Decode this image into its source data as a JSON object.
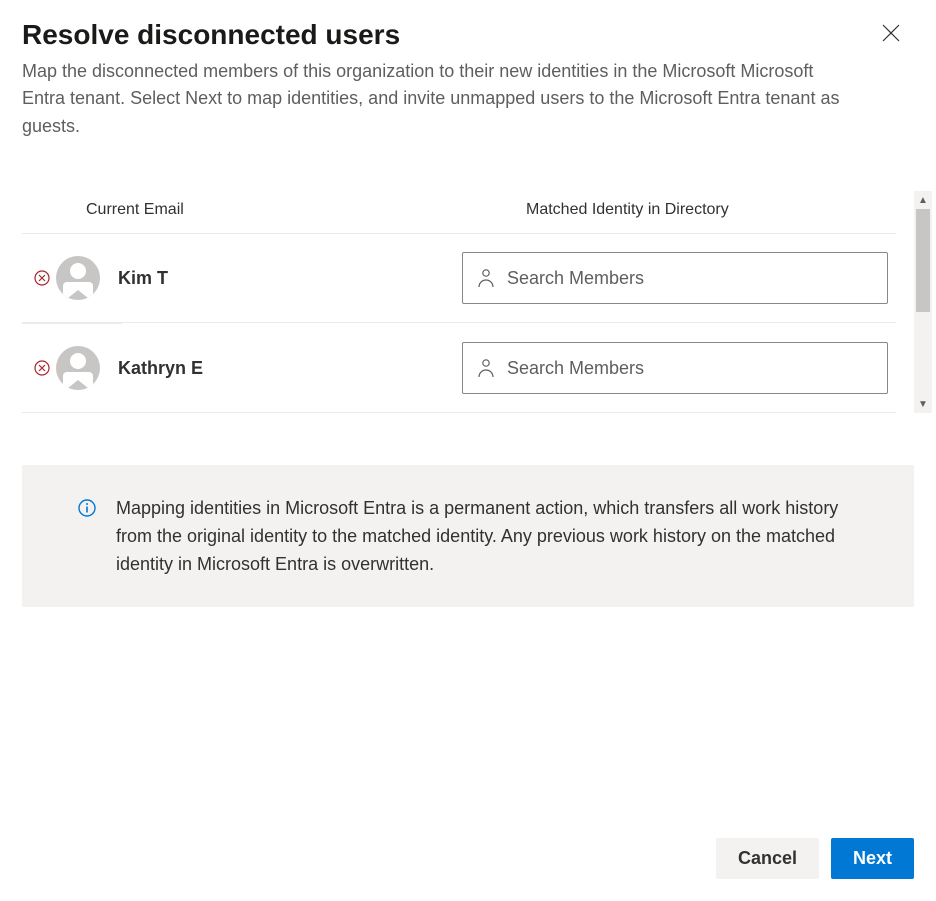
{
  "header": {
    "title": "Resolve disconnected users",
    "subtitle": "Map the disconnected members of this organization to their new identities in the Microsoft Microsoft Entra tenant. Select Next to map identities, and invite unmapped users to the Microsoft Entra tenant as guests."
  },
  "columns": {
    "email": "Current Email",
    "matched": "Matched Identity in Directory"
  },
  "search_placeholder": "Search Members",
  "users": [
    {
      "name": "Kim T"
    },
    {
      "name": "Kathryn E"
    }
  ],
  "info": {
    "text": "Mapping identities in Microsoft Entra is a permanent action, which transfers all work history from the original identity to the matched identity. Any previous work history on the matched identity in Microsoft Entra is overwritten."
  },
  "footer": {
    "cancel": "Cancel",
    "next": "Next"
  }
}
